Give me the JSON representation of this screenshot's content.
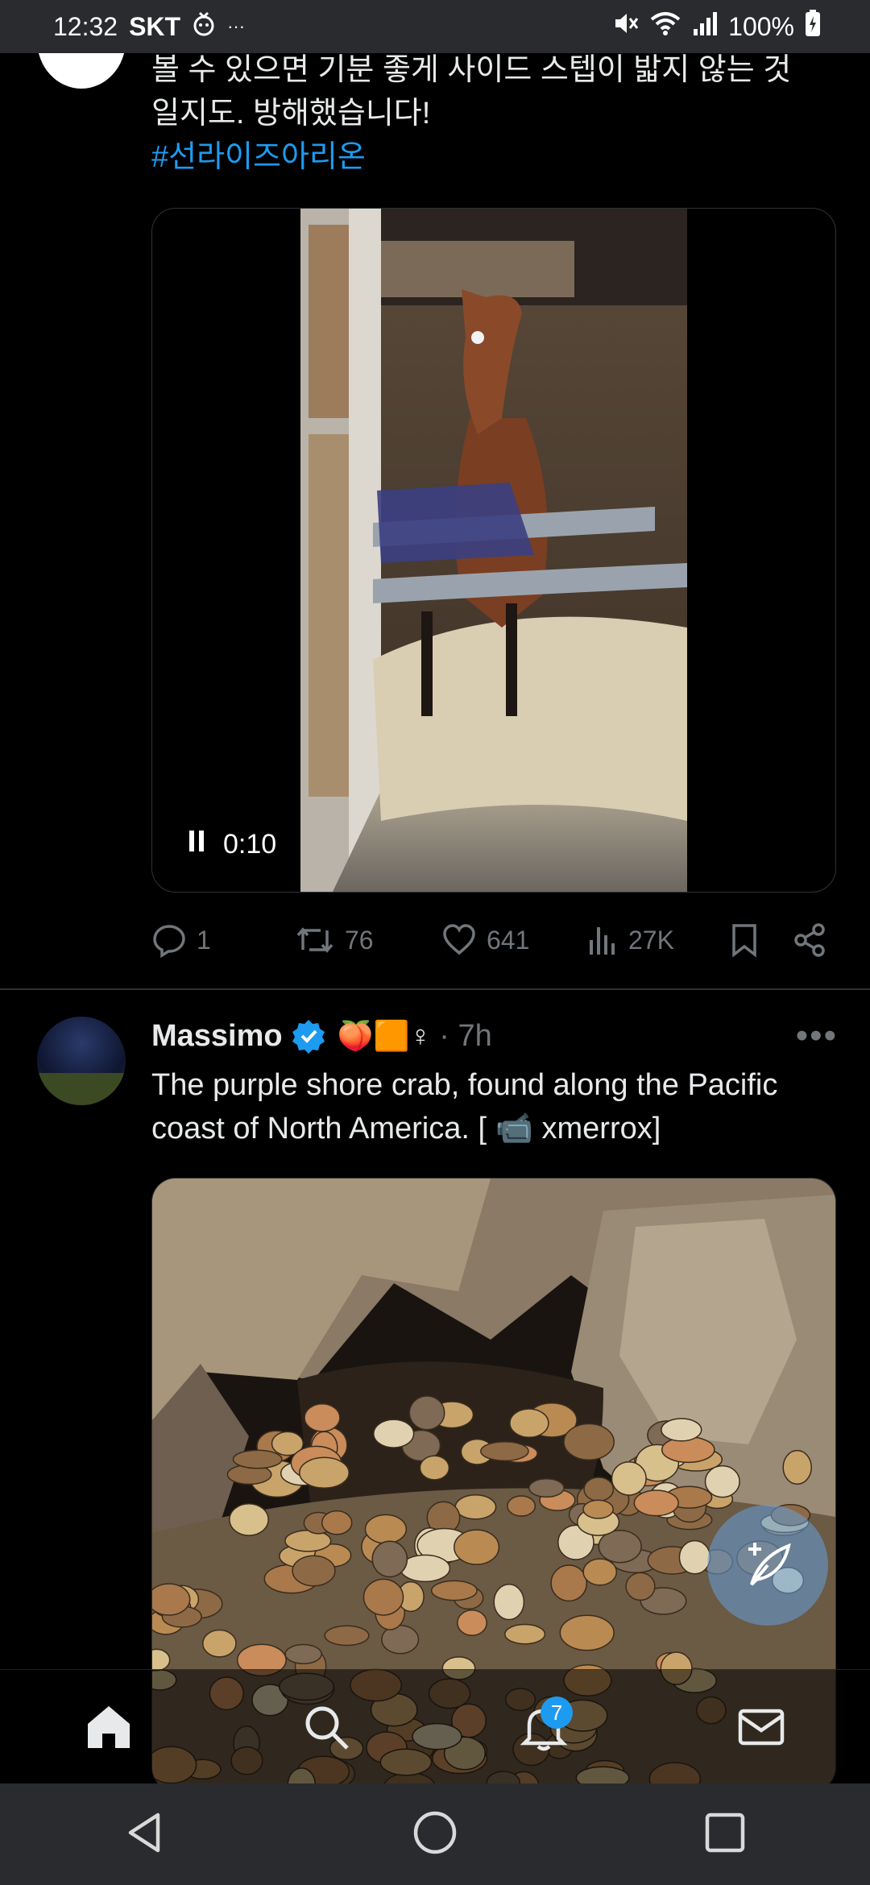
{
  "status_bar": {
    "time": "12:32",
    "carrier": "SKT",
    "extra": "···",
    "battery": "100%"
  },
  "tweet1": {
    "text_line1": "볼 수 있으면 기분 좋게 사이드 스텝이 밟지 않는 것",
    "text_line2": "일지도. 방해했습니다!",
    "hashtag": "#선라이즈아리온",
    "video_time": "0:10",
    "replies": "1",
    "retweets": "76",
    "likes": "641",
    "views": "27K"
  },
  "tweet2": {
    "author": "Massimo",
    "badges": "🍑🟧♀",
    "meta": "· 7h",
    "text_line1": "The purple shore crab, found along the Pacific",
    "text_line2_a": "coast of North America. [",
    "camera_glyph": "📹",
    "text_line2_b": "xmerrox]"
  },
  "bottom_nav": {
    "notifications_count": "7"
  },
  "colors": {
    "accent": "#1d9bf0",
    "muted": "#71767b",
    "background": "#000000"
  }
}
